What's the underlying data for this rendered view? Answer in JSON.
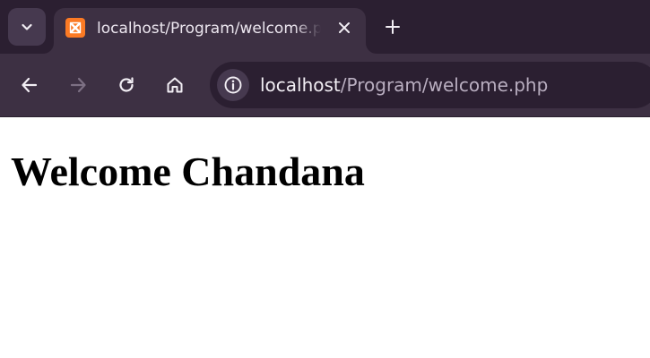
{
  "tab": {
    "title": "localhost/Program/welcome.php",
    "favicon": "xampp-icon"
  },
  "omnibox": {
    "host": "localhost",
    "path": "/Program/welcome.php"
  },
  "page": {
    "heading": "Welcome Chandana"
  },
  "colors": {
    "tabstrip_bg": "#2b1f31",
    "toolbar_bg": "#3d3043",
    "favicon_bg": "#fb7a24"
  },
  "icons": {
    "tab_search": "chevron-down-icon",
    "close": "close-icon",
    "new_tab": "plus-icon",
    "back": "back-arrow-icon",
    "forward": "forward-arrow-icon",
    "reload": "reload-icon",
    "home": "home-icon",
    "site_info": "info-icon"
  }
}
